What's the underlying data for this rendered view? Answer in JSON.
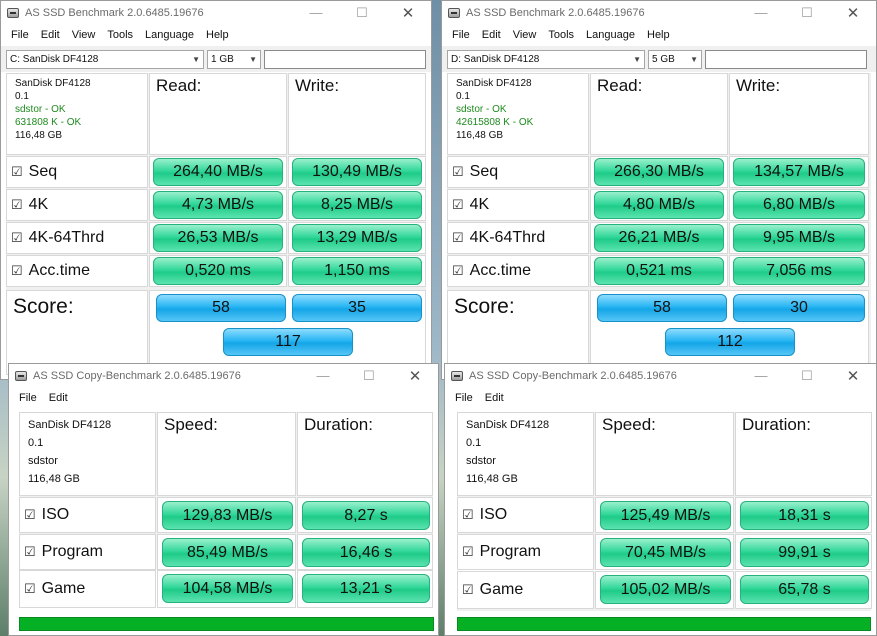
{
  "bench1": {
    "title": "AS SSD Benchmark 2.0.6485.19676",
    "menu": [
      "File",
      "Edit",
      "View",
      "Tools",
      "Language",
      "Help"
    ],
    "drive_select": "C: SanDisk DF4128",
    "size_select": "1 GB",
    "info": {
      "model": "SanDisk DF4128",
      "fw": "0.1",
      "driver": "sdstor - OK",
      "align": "631808 K - OK",
      "capacity": "116,48 GB"
    },
    "read_label": "Read:",
    "write_label": "Write:",
    "rows": [
      {
        "label": "Seq",
        "read": "264,40 MB/s",
        "write": "130,49 MB/s"
      },
      {
        "label": "4K",
        "read": "4,73 MB/s",
        "write": "8,25 MB/s"
      },
      {
        "label": "4K-64Thrd",
        "read": "26,53 MB/s",
        "write": "13,29 MB/s"
      },
      {
        "label": "Acc.time",
        "read": "0,520 ms",
        "write": "1,150 ms"
      }
    ],
    "score_label": "Score:",
    "score_read": "58",
    "score_write": "35",
    "score_total": "117"
  },
  "bench2": {
    "title": "AS SSD Benchmark 2.0.6485.19676",
    "menu": [
      "File",
      "Edit",
      "View",
      "Tools",
      "Language",
      "Help"
    ],
    "drive_select": "D: SanDisk DF4128",
    "size_select": "5 GB",
    "info": {
      "model": "SanDisk DF4128",
      "fw": "0.1",
      "driver": "sdstor - OK",
      "align": "42615808 K - OK",
      "capacity": "116,48 GB"
    },
    "read_label": "Read:",
    "write_label": "Write:",
    "rows": [
      {
        "label": "Seq",
        "read": "266,30 MB/s",
        "write": "134,57 MB/s"
      },
      {
        "label": "4K",
        "read": "4,80 MB/s",
        "write": "6,80 MB/s"
      },
      {
        "label": "4K-64Thrd",
        "read": "26,21 MB/s",
        "write": "9,95 MB/s"
      },
      {
        "label": "Acc.time",
        "read": "0,521 ms",
        "write": "7,056 ms"
      }
    ],
    "score_label": "Score:",
    "score_read": "58",
    "score_write": "30",
    "score_total": "112"
  },
  "copy1": {
    "title": "AS SSD Copy-Benchmark 2.0.6485.19676",
    "menu": [
      "File",
      "Edit"
    ],
    "info": {
      "model": "SanDisk DF4128",
      "fw": "0.1",
      "driver": "sdstor",
      "capacity": "116,48 GB"
    },
    "speed_label": "Speed:",
    "duration_label": "Duration:",
    "rows": [
      {
        "label": "ISO",
        "speed": "129,83 MB/s",
        "duration": "8,27 s"
      },
      {
        "label": "Program",
        "speed": "85,49 MB/s",
        "duration": "16,46 s"
      },
      {
        "label": "Game",
        "speed": "104,58 MB/s",
        "duration": "13,21 s"
      }
    ],
    "progress": 1.0
  },
  "copy2": {
    "title": "AS SSD Copy-Benchmark 2.0.6485.19676",
    "menu": [
      "File",
      "Edit"
    ],
    "info": {
      "model": "SanDisk DF4128",
      "fw": "0.1",
      "driver": "sdstor",
      "capacity": "116,48 GB"
    },
    "speed_label": "Speed:",
    "duration_label": "Duration:",
    "rows": [
      {
        "label": "ISO",
        "speed": "125,49 MB/s",
        "duration": "18,31 s"
      },
      {
        "label": "Program",
        "speed": "70,45 MB/s",
        "duration": "99,91 s"
      },
      {
        "label": "Game",
        "speed": "105,02 MB/s",
        "duration": "65,78 s"
      }
    ],
    "progress": 1.0
  },
  "caption": {
    "minimize": "—",
    "maximize": "☐",
    "close": "✕"
  },
  "checkbox_glyph": "☑",
  "colors": {
    "green_bar": "#33d89a",
    "blue_score": "#27b5f2",
    "progress": "#06b025",
    "ok_text": "#1e8a1e"
  }
}
